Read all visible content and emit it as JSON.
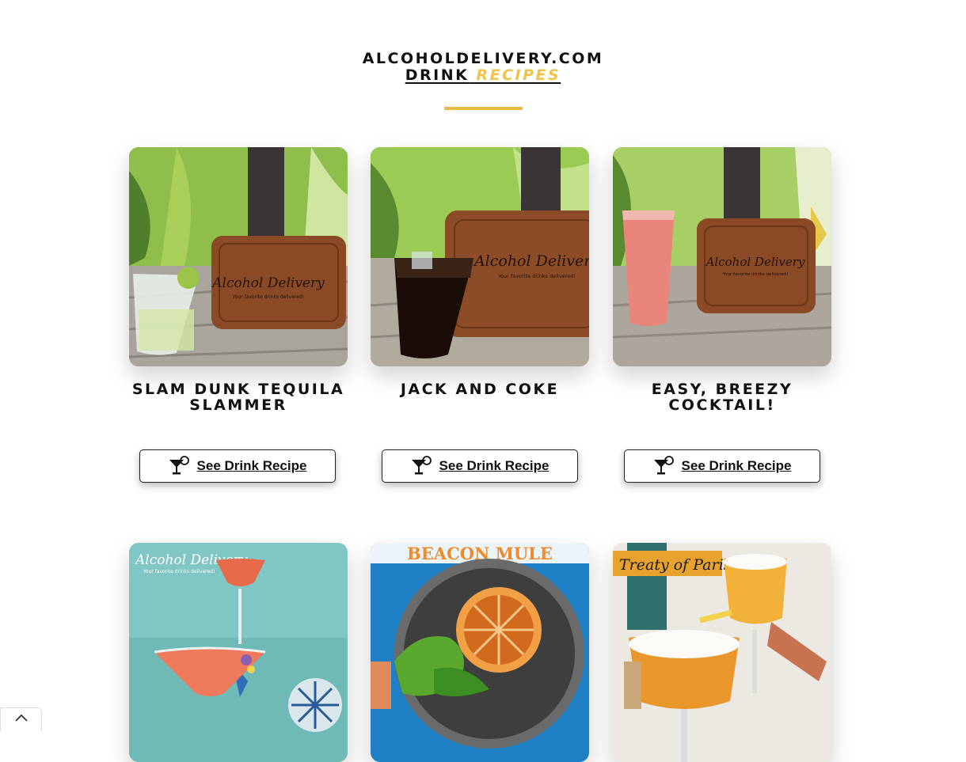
{
  "header": {
    "line1": "ALCOHOLDELIVERY.COM",
    "line2_prefix": "DRINK",
    "line2_accent": "RECIPES"
  },
  "colors": {
    "accent": "#f0c34a",
    "divider": "#e8b845",
    "text": "#111111"
  },
  "recipes": [
    {
      "title": "SLAM DUNK TEQUILA SLAMMER",
      "button_label": "See Drink Recipe",
      "button_icon": "cocktail-glass-icon",
      "image_wordmark": "Alcohol Delivery",
      "image_tagline": "Your favorite drinks delivered!"
    },
    {
      "title": "JACK AND COKE",
      "button_label": "See Drink Recipe",
      "button_icon": "cocktail-glass-icon",
      "image_wordmark": "Alcohol Delivery",
      "image_tagline": "Your favorite drinks delivered!"
    },
    {
      "title": "EASY, BREEZY COCKTAIL!",
      "button_label": "See Drink Recipe",
      "button_icon": "cocktail-glass-icon",
      "image_wordmark": "Alcohol Delivery",
      "image_tagline": "Your favorite drinks delivered!"
    },
    {
      "image_wordmark": "Alcohol Delivery",
      "image_tagline": "Your favorite drinks delivered!"
    },
    {
      "image_text": "BEACON MULE"
    },
    {
      "image_text": "Treaty of Paris"
    }
  ],
  "scroll_top_icon": "chevron-up-icon"
}
